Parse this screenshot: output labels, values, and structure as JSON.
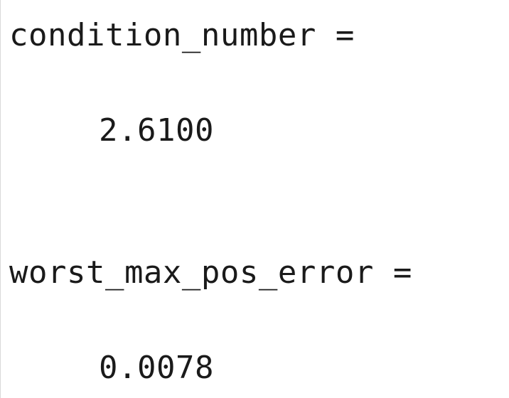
{
  "console": {
    "outputs": [
      {
        "name": "condition_number",
        "equals": "=",
        "value": "2.6100"
      },
      {
        "name": "worst_max_pos_error",
        "equals": "=",
        "value": "0.0078"
      }
    ]
  }
}
